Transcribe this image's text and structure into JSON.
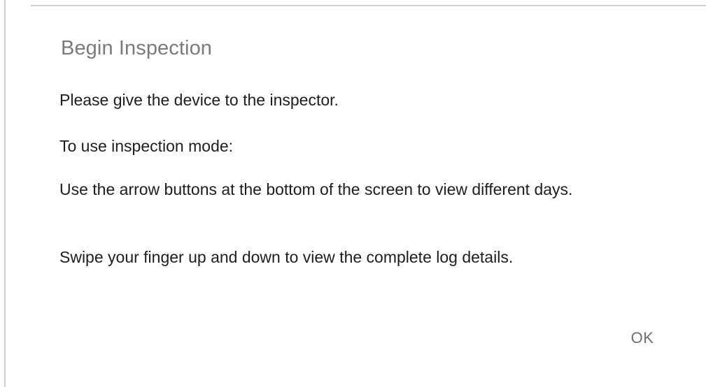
{
  "dialog": {
    "title": "Begin Inspection",
    "paragraphs": [
      "Please give the device to the inspector.",
      "To use inspection mode:",
      "Use the arrow buttons at the bottom of the screen to view different days.",
      "Swipe your finger up and down to view the complete log details."
    ],
    "ok_label": "OK"
  }
}
